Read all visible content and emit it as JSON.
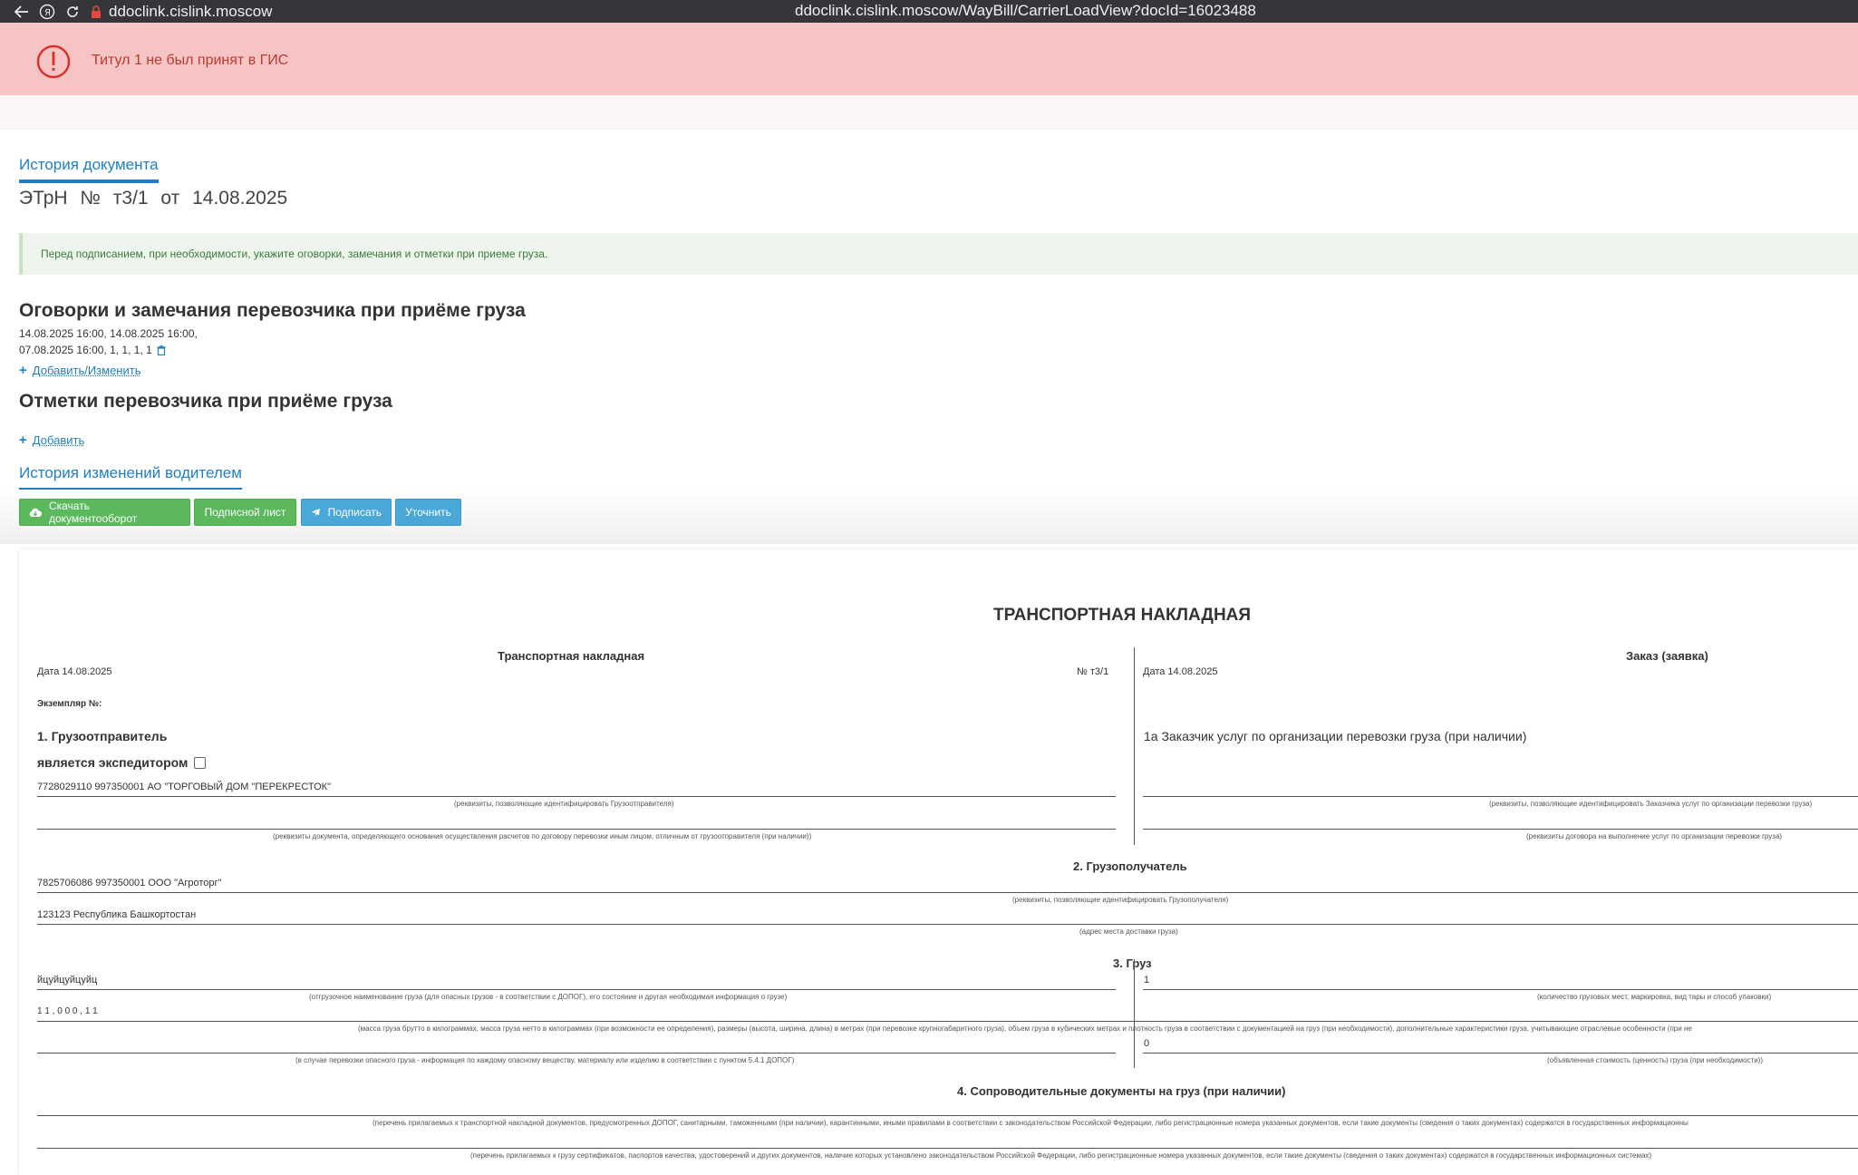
{
  "browser": {
    "site": "ddoclink.cislink.moscow",
    "url": "ddoclink.cislink.moscow/WayBill/CarrierLoadView?docId=16023488"
  },
  "alert": {
    "text": "Титул 1 не был принят в ГИС"
  },
  "header": {
    "history_link": "История документа",
    "doc_title": "ЭТрН №  т3/1  от  14.08.2025",
    "hint": "Перед подписанием, при необходимости, укажите оговорки, замечания и отметки при приеме груза."
  },
  "remarks": {
    "title": "Оговорки и замечания перевозчика при приёме груза",
    "line1": "14.08.2025  16:00, 14.08.2025  16:00,",
    "line2": "07.08.2025  16:00, 1, 1, 1, 1",
    "add_change": "Добавить/Изменить"
  },
  "marks": {
    "title": "Отметки перевозчика при приёме груза",
    "add": "Добавить",
    "driver_history": "История изменений водителем"
  },
  "buttons": {
    "download": "Скачать документооборот",
    "signature_sheet": "Подписной лист",
    "sign": "Подписать",
    "clarify": "Уточнить"
  },
  "document": {
    "main_title": "ТРАНСПОРТНАЯ НАКЛАДНАЯ",
    "left_title": "Транспортная накладная",
    "right_title": "Заказ (заявка)",
    "left_date": "Дата  14.08.2025",
    "number": "№   т3/1",
    "right_date": "Дата 14.08.2025",
    "copy": "Экземпляр №:",
    "s1_title": "1. Грузоотправитель",
    "s1_forwarder": "является экспедитором",
    "s1_value": "7728029110 997350001 АО \"ТОРГОВЫЙ ДОМ \"ПЕРЕКРЕСТОК\"",
    "s1_cap1": "(реквизиты, позволяющие идентифицировать Грузоотправителя)",
    "s1_cap2": "(реквизиты документа, определяющего основания осуществления расчетов по договору перевозки иным лицом, отличным от грузоотправителя (при наличии))",
    "s1a_title": "1а Заказчик услуг по организации перевозки груза (при наличии)",
    "s1a_cap1": "(реквизиты, позволяющие идентифицировать Заказчика услуг по организации перевозки груза)",
    "s1a_cap2": "(реквизиты договора на выполнение услуг по организации перевозки груза)",
    "s2_title": "2. Грузополучатель",
    "s2_value": "7825706086 997350001 ООО \"Агроторг\"",
    "s2_cap1": "(реквизиты, позволяющие идентифицировать Грузополучателя)",
    "s2_addr": "123123 Республика Башкортостан",
    "s2_cap2": "(адрес места доставки груза)",
    "s3_title": "3. Груз",
    "s3_name": "йцуйцуйцуйц",
    "s3_name_cap": "(отгрузочное наименование груза (для опасных грузов - в соответствии с ДОПОГ), его состояние и другая необходимая информация о грузе)",
    "s3_places": "1",
    "s3_places_cap": "(количество грузовых мест, маркировка, вид тары и способ упаковки)",
    "s3_mass": "1 1 , 0 0 0 , 1 1",
    "s3_mass_cap": "(масса груза брутто в килограммах, масса груза нетто в килограммах (при возможности ее определения), размеры (высота, ширина, длина) в метрах (при перевозке крупногабаритного груза), объем груза в кубических метрах и плотность груза в соответствии с документацией на груз (при необходимости), дополнительные характеристики груза, учитывающие отраслевые особенности (при не",
    "s3_danger_cap": "(в случае перевозки опасного груза - информация по каждому опасному веществу, материалу или изделию в соответствии с пунктом 5.4.1 ДОПОГ)",
    "s3_value": "0",
    "s3_value_cap": "(объявленная стоимость (ценность) груза (при необходимости))",
    "s4_title": "4. Сопроводительные документы на груз (при наличии)",
    "s4_cap1": "(перечень прилагаемых к транспортной накладной документов, предусмотренных ДОПОГ, санитарными, таможенными (при наличии), карантинными, иными правилами в соответствии с законодательством Российской Федерации, либо регистрационные номера указанных документов, если такие документы (сведения о таких документах) содержатся в государственных информационны",
    "s4_cap2": "(перечень прилагаемых к грузу сертификатов, паспортов качества, удостоверений и других документов, наличие которых установлено законодательством Российской Федерации, либо регистрационные номера указанных документов, если такие документы (сведения о таких документах) содержатся в государственных информационных системах)"
  },
  "colors": {
    "alert_bg": "#f6c4c4",
    "alert_text": "#c0392b",
    "link": "#1e7fc7",
    "btn_green": "#5cb85c",
    "btn_blue": "#4aa8d8"
  }
}
